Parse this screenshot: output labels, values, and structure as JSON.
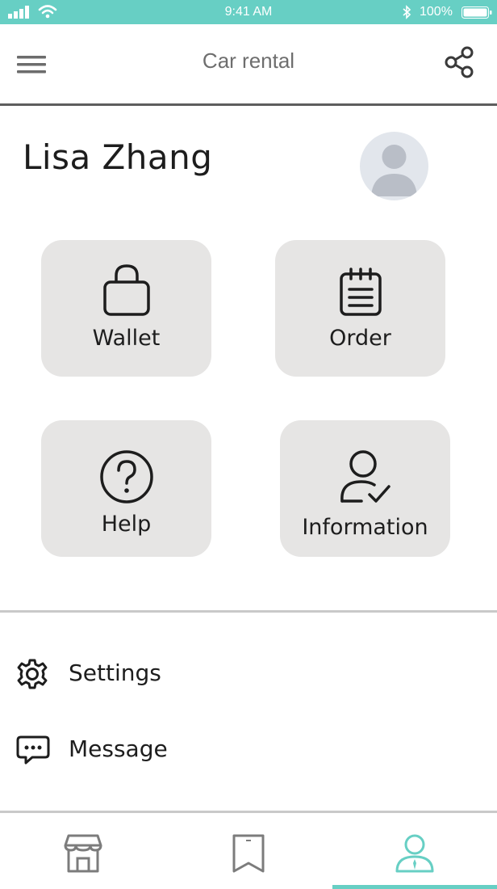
{
  "status_bar": {
    "time": "9:41 AM",
    "battery": "100%",
    "icons": [
      "signal-icon",
      "wifi-icon",
      "bluetooth-icon",
      "battery-icon"
    ]
  },
  "header": {
    "title": "Car rental",
    "menu_icon": "hamburger-menu-icon",
    "share_icon": "share-icon"
  },
  "profile": {
    "name": "Lisa Zhang",
    "avatar_icon": "avatar-placeholder-icon"
  },
  "tiles": [
    {
      "label": "Wallet",
      "icon": "shopping-bag-icon"
    },
    {
      "label": "Order",
      "icon": "clipboard-icon"
    },
    {
      "label": "Help",
      "icon": "question-circle-icon"
    },
    {
      "label": "Information",
      "icon": "user-check-icon"
    }
  ],
  "list": [
    {
      "label": "Settings",
      "icon": "gear-icon"
    },
    {
      "label": "Message",
      "icon": "chat-icon"
    }
  ],
  "bottom_nav": {
    "items": [
      {
        "icon": "store-icon"
      },
      {
        "icon": "bookmark-icon"
      },
      {
        "icon": "user-icon",
        "active": true
      }
    ]
  },
  "colors": {
    "accent": "#67cfc4",
    "tile_bg": "#e6e5e4",
    "header_title": "#6e6e6e",
    "divider_dark": "#5d5d5d",
    "divider_light": "#c9c9c9",
    "inactive_icon": "#7c7c7c"
  }
}
